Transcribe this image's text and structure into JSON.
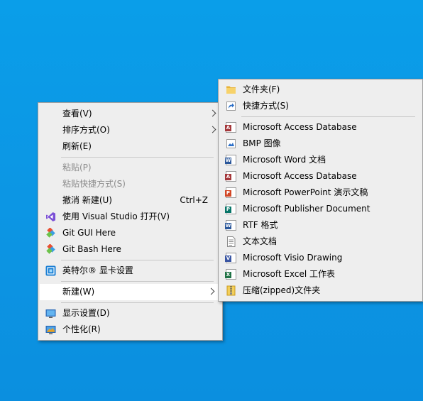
{
  "colors": {
    "desktop": "#0b96e4",
    "menu_bg": "#eeeeee",
    "highlight": "#ffffff",
    "disabled_text": "#8c8c8c"
  },
  "main_menu": {
    "view": "查看(V)",
    "sort": "排序方式(O)",
    "refresh": "刷新(E)",
    "paste": "粘贴(P)",
    "paste_shortcut": "粘贴快捷方式(S)",
    "undo_new": "撤消 新建(U)",
    "undo_shortcut": "Ctrl+Z",
    "open_vs": "使用 Visual Studio 打开(V)",
    "git_gui": "Git GUI Here",
    "git_bash": "Git Bash Here",
    "intel_graphics": "英特尔® 显卡设置",
    "new": "新建(W)",
    "display_settings": "显示设置(D)",
    "personalize": "个性化(R)"
  },
  "new_submenu": {
    "folder": "文件夹(F)",
    "shortcut": "快捷方式(S)",
    "items": [
      {
        "label": "Microsoft Access Database",
        "icon": "access-icon"
      },
      {
        "label": "BMP 图像",
        "icon": "bmp-icon"
      },
      {
        "label": "Microsoft Word 文档",
        "icon": "word-icon"
      },
      {
        "label": "Microsoft Access Database",
        "icon": "access-icon"
      },
      {
        "label": "Microsoft PowerPoint 演示文稿",
        "icon": "powerpoint-icon"
      },
      {
        "label": "Microsoft Publisher Document",
        "icon": "publisher-icon"
      },
      {
        "label": "RTF 格式",
        "icon": "rtf-icon"
      },
      {
        "label": "文本文档",
        "icon": "text-document-icon"
      },
      {
        "label": "Microsoft Visio Drawing",
        "icon": "visio-icon"
      },
      {
        "label": "Microsoft Excel 工作表",
        "icon": "excel-icon"
      },
      {
        "label": "压缩(zipped)文件夹",
        "icon": "zip-folder-icon"
      }
    ]
  }
}
